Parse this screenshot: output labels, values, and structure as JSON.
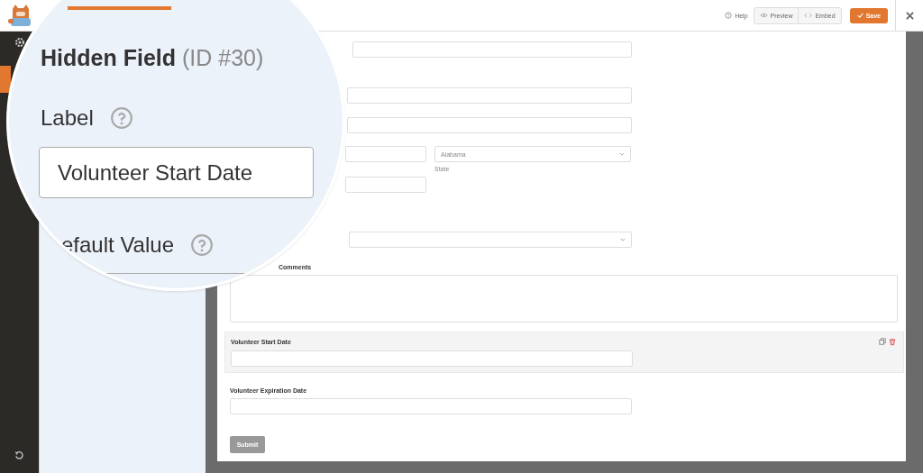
{
  "top_bar": {
    "help": "Help",
    "preview": "Preview",
    "embed": "Embed",
    "save": "Save"
  },
  "magnifier": {
    "title": "Hidden Field",
    "id_text": "(ID #30)",
    "label_caption": "Label",
    "label_value": "Volunteer Start Date",
    "default_caption": "efault Value"
  },
  "form": {
    "rows": [
      {
        "kind": "input"
      },
      {
        "kind": "input"
      },
      {
        "kind": "input"
      },
      {
        "kind": "pair",
        "select_value": "Alabama",
        "sublabel": "State"
      },
      {
        "kind": "half"
      },
      {
        "kind": "select"
      },
      {
        "kind": "textarea",
        "label": "Comments"
      },
      {
        "kind": "input",
        "label": "Volunteer Start Date",
        "selected": true
      },
      {
        "kind": "input",
        "label": "Volunteer Expiration Date",
        "selected": false
      }
    ],
    "submit": "Submit"
  }
}
